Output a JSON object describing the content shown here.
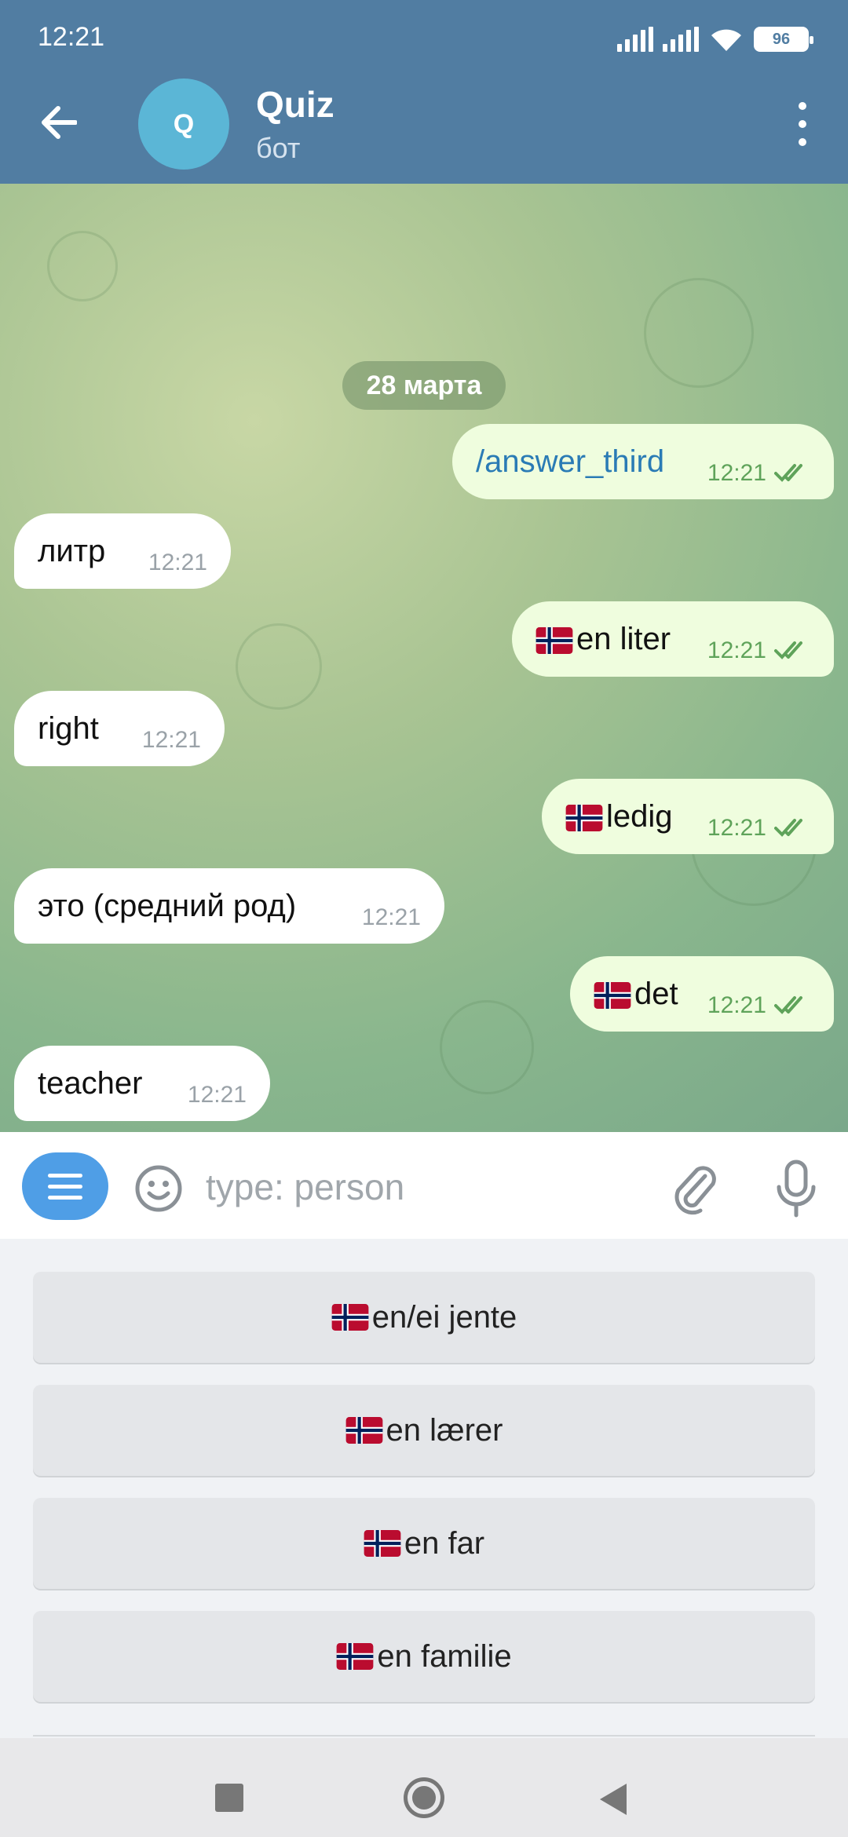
{
  "status_bar": {
    "time": "12:21",
    "battery": "96"
  },
  "header": {
    "avatar_letter": "Q",
    "title": "Quiz",
    "subtitle": "бот"
  },
  "chat": {
    "date": "28 марта",
    "messages": [
      {
        "dir": "out",
        "text": "/answer_third",
        "time": "12:21",
        "flag": false,
        "command": true
      },
      {
        "dir": "in",
        "text": "литр",
        "time": "12:21",
        "flag": false
      },
      {
        "dir": "out",
        "text": "en liter",
        "time": "12:21",
        "flag": true
      },
      {
        "dir": "in",
        "text": "right",
        "time": "12:21",
        "flag": false
      },
      {
        "dir": "out",
        "text": "ledig",
        "time": "12:21",
        "flag": true
      },
      {
        "dir": "in",
        "text": "это (средний род)",
        "time": "12:21",
        "flag": false
      },
      {
        "dir": "out",
        "text": "det",
        "time": "12:21",
        "flag": true
      },
      {
        "dir": "in",
        "text": "teacher",
        "time": "12:21",
        "flag": false
      }
    ]
  },
  "input": {
    "placeholder": "type: person"
  },
  "keyboard": {
    "buttons": [
      "en/ei jente",
      "en lærer",
      "en far",
      "en familie"
    ]
  },
  "icons": {
    "back": "arrow-left-icon",
    "menu": "more-vertical-icon",
    "emoji": "smile-icon",
    "attach": "paperclip-icon",
    "mic": "microphone-icon",
    "flag": "norway-flag-icon"
  },
  "colors": {
    "header": "#517da2",
    "out_bubble": "#effdde",
    "in_bubble": "#ffffff",
    "accent": "#4f9ee6",
    "read_check": "#5fa35a"
  }
}
